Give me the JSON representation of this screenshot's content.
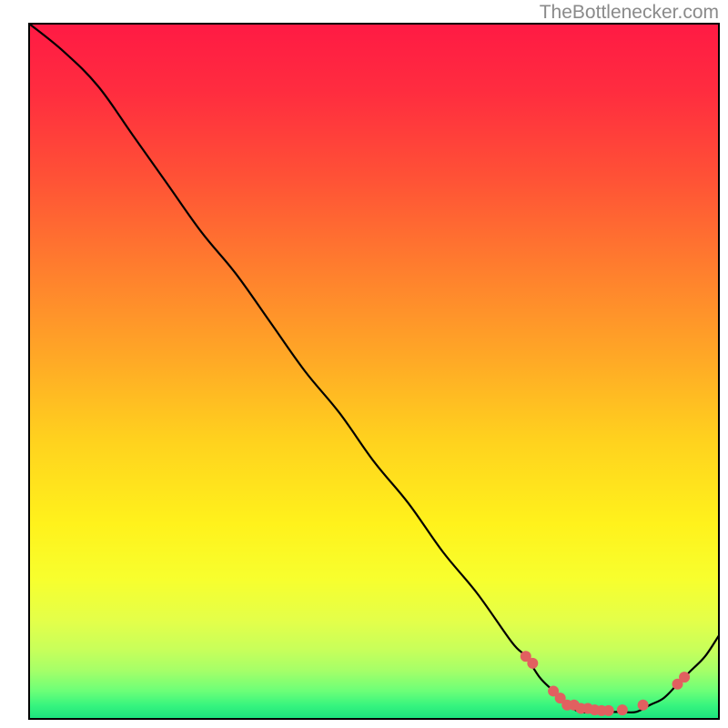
{
  "watermark": "TheBottlenecker.com",
  "chart_data": {
    "type": "line",
    "title": "",
    "xlabel": "",
    "ylabel": "",
    "xlim": [
      0,
      100
    ],
    "ylim": [
      0,
      100
    ],
    "grid": false,
    "legend": "none",
    "series": [
      {
        "name": "curve",
        "x": [
          0,
          5,
          10,
          15,
          20,
          25,
          30,
          35,
          40,
          45,
          50,
          55,
          60,
          65,
          70,
          72,
          74,
          76,
          78,
          80,
          82,
          84,
          86,
          88,
          90,
          92,
          94,
          96,
          98,
          100
        ],
        "y": [
          100,
          96,
          91,
          84,
          77,
          70,
          64,
          57,
          50,
          44,
          37,
          31,
          24,
          18,
          11,
          9,
          6,
          4,
          2,
          1,
          1,
          1,
          1,
          1,
          2,
          3,
          5,
          7,
          9,
          12
        ]
      },
      {
        "name": "highlight-dots",
        "x": [
          72,
          73,
          76,
          77,
          78,
          79,
          80,
          81,
          82,
          83,
          84,
          86,
          89,
          94,
          95
        ],
        "y": [
          9,
          8,
          4,
          3,
          2,
          2,
          1.5,
          1.5,
          1.3,
          1.2,
          1.2,
          1.3,
          2,
          5,
          6
        ]
      }
    ],
    "background": {
      "gradient_stops": [
        {
          "pos": 0.0,
          "color": "#ff1a44"
        },
        {
          "pos": 0.1,
          "color": "#ff2d3f"
        },
        {
          "pos": 0.22,
          "color": "#ff5136"
        },
        {
          "pos": 0.35,
          "color": "#ff7d2e"
        },
        {
          "pos": 0.48,
          "color": "#ffa826"
        },
        {
          "pos": 0.6,
          "color": "#ffd21e"
        },
        {
          "pos": 0.72,
          "color": "#fff21c"
        },
        {
          "pos": 0.8,
          "color": "#f7ff2e"
        },
        {
          "pos": 0.86,
          "color": "#e3ff4a"
        },
        {
          "pos": 0.9,
          "color": "#c8ff5a"
        },
        {
          "pos": 0.93,
          "color": "#a6ff68"
        },
        {
          "pos": 0.96,
          "color": "#6cff78"
        },
        {
          "pos": 0.98,
          "color": "#38f57e"
        },
        {
          "pos": 1.0,
          "color": "#1ae27e"
        }
      ]
    },
    "curve_color": "#000000",
    "dot_color": "#e16060",
    "dot_radius": 6
  }
}
